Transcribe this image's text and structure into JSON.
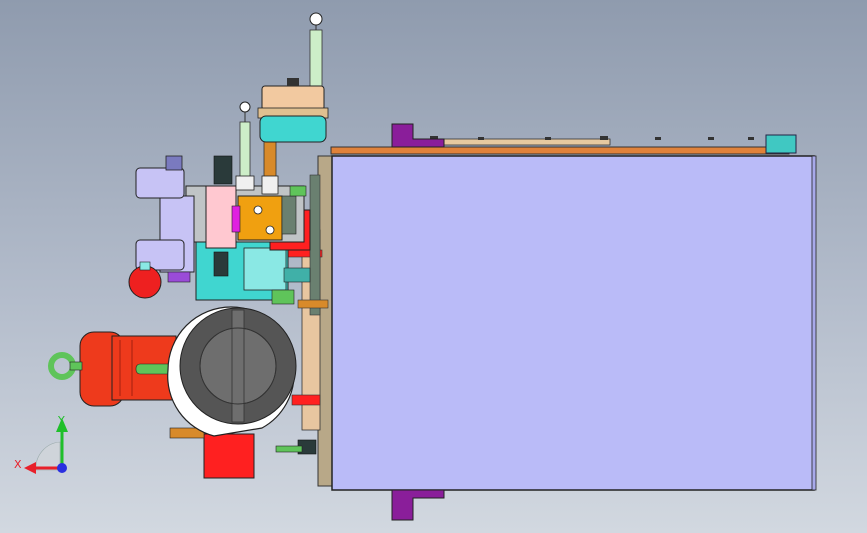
{
  "viewport": {
    "background_top": "#8f9bae",
    "background_bottom": "#d2d8e0"
  },
  "triad": {
    "x_label": "X",
    "y_label": "Y",
    "x_color": "#e8202a",
    "y_color": "#1fbf2a",
    "z_color": "#2a30e0"
  },
  "colors": {
    "tank": "#babbf8",
    "tank_lid": "#e0823a",
    "motor": "#ee3a1c",
    "pump_flange": "#ffffff",
    "pump_body": "#6e6e6e",
    "bracket": "#8a1e9a",
    "valve": "#c7c3f5",
    "accumulator_cap": "#f2c9a0",
    "accumulator_base": "#40d6d0",
    "manifold": "#f0a010",
    "pipe_green": "#5fc45a",
    "red_block": "#ff2020"
  }
}
